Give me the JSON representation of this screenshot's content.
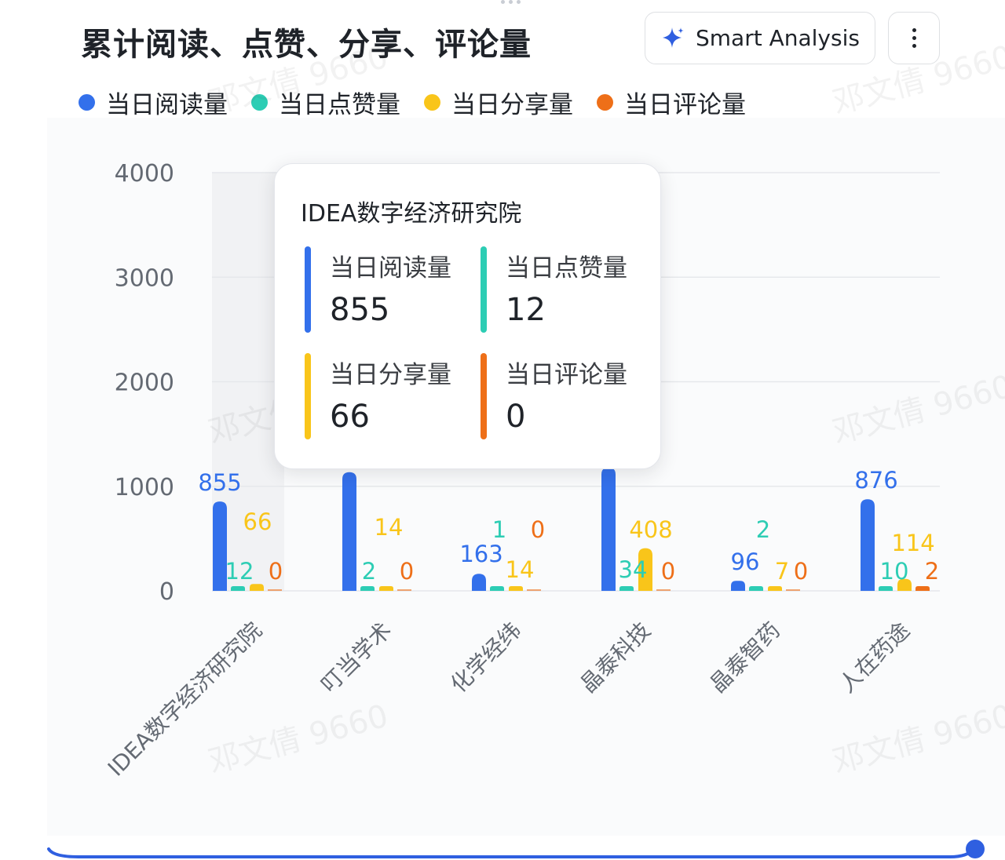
{
  "header": {
    "title": "累计阅读、点赞、分享、评论量",
    "smart_label": "Smart Analysis"
  },
  "legend": [
    {
      "label": "当日阅读量",
      "color": "#3370eb"
    },
    {
      "label": "当日点赞量",
      "color": "#2dcdb4"
    },
    {
      "label": "当日分享量",
      "color": "#f9c51a"
    },
    {
      "label": "当日评论量",
      "color": "#ee6f18"
    }
  ],
  "watermark_text": "邓文倩 9660",
  "tooltip": {
    "title": "IDEA数字经济研究院",
    "items": [
      {
        "name": "当日阅读量",
        "value": "855",
        "color": "#3370eb"
      },
      {
        "name": "当日点赞量",
        "value": "12",
        "color": "#2dcdb4"
      },
      {
        "name": "当日分享量",
        "value": "66",
        "color": "#f9c51a"
      },
      {
        "name": "当日评论量",
        "value": "0",
        "color": "#ee6f18"
      }
    ]
  },
  "chart_data": {
    "type": "bar",
    "title": "累计阅读、点赞、分享、评论量",
    "categories": [
      "IDEA数字经济研究院",
      "叮当学术",
      "化学经纬",
      "晶泰科技",
      "晶泰智药",
      "人在药途"
    ],
    "series": [
      {
        "name": "当日阅读量",
        "color": "#3370eb",
        "values": [
          855,
          1135,
          163,
          1180,
          96,
          876
        ],
        "labels": [
          "855",
          "",
          "163",
          "",
          "96",
          "876"
        ]
      },
      {
        "name": "当日点赞量",
        "color": "#2dcdb4",
        "values": [
          12,
          2,
          1,
          34,
          2,
          10
        ],
        "labels": [
          "12",
          "2",
          "1",
          "34",
          "2",
          "10"
        ]
      },
      {
        "name": "当日分享量",
        "color": "#f9c51a",
        "values": [
          66,
          14,
          14,
          408,
          7,
          114
        ],
        "labels": [
          "66",
          "14",
          "14",
          "408",
          "7",
          "114"
        ]
      },
      {
        "name": "当日评论量",
        "color": "#ee6f18",
        "values": [
          0,
          0,
          0,
          0,
          0,
          2
        ],
        "labels": [
          "0",
          "0",
          "0",
          "0",
          "0",
          "2"
        ]
      }
    ],
    "ylim": [
      0,
      4000
    ],
    "yticks": [
      "4000",
      "3000",
      "2000",
      "1000",
      "0"
    ],
    "ytick_values": [
      4000,
      3000,
      2000,
      1000,
      0
    ],
    "grid": true,
    "legend_position": "top-left",
    "highlighted_category": "IDEA数字经济研究院"
  }
}
